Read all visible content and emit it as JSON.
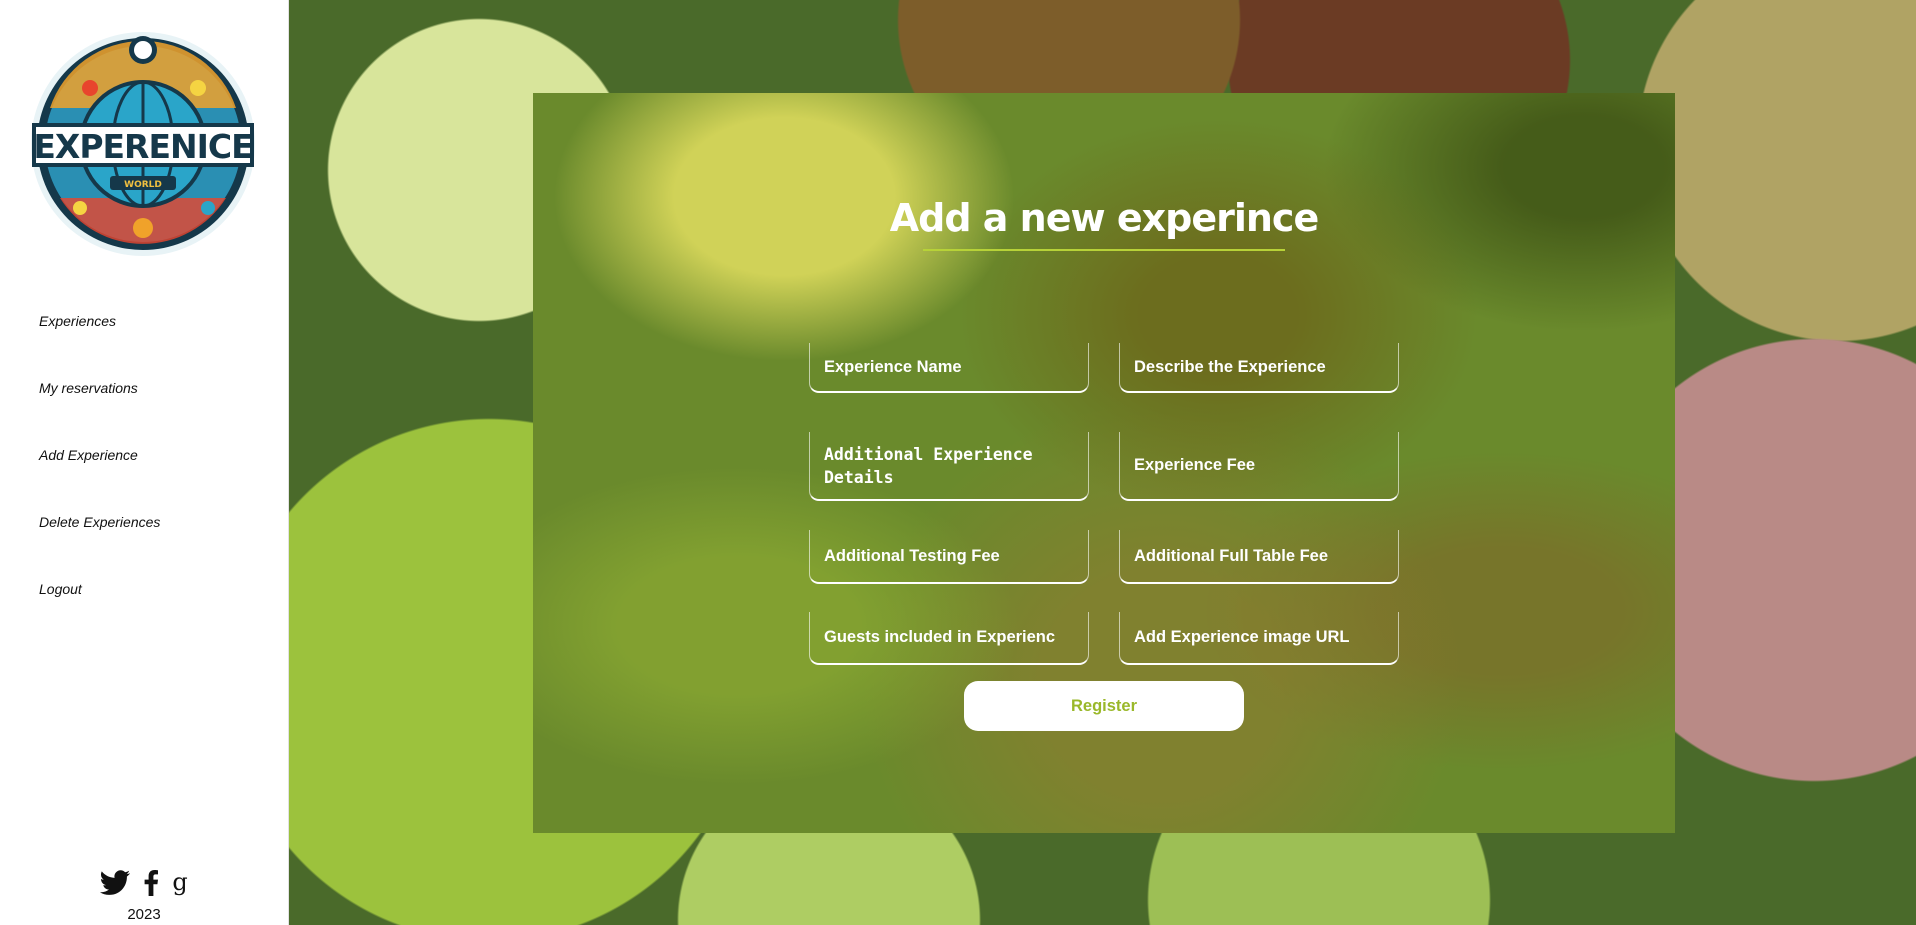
{
  "sidebar": {
    "logo": {
      "text": "EXPERENICE",
      "subtext": "WORLD"
    },
    "nav": [
      {
        "label": "Experiences"
      },
      {
        "label": "My reservations"
      },
      {
        "label": "Add Experience"
      },
      {
        "label": "Delete Experiences"
      },
      {
        "label": "Logout"
      }
    ],
    "social": [
      "twitter-icon",
      "facebook-icon",
      "google-icon"
    ],
    "year": "2023"
  },
  "main": {
    "title": "Add a new experince",
    "fields": {
      "name": "Experience Name",
      "describe": "Describe the Experience",
      "details": "Additional Experience Details",
      "fee": "Experience Fee",
      "testing_fee": "Additional Testing Fee",
      "table_fee": "Additional Full Table Fee",
      "guests": "Guests included in Experienc",
      "image_url": "Add Experience image URL"
    },
    "register_label": "Register"
  },
  "colors": {
    "accent": "#b7d238",
    "register_text": "#9ab82a",
    "sidebar_bg": "#ffffff"
  }
}
